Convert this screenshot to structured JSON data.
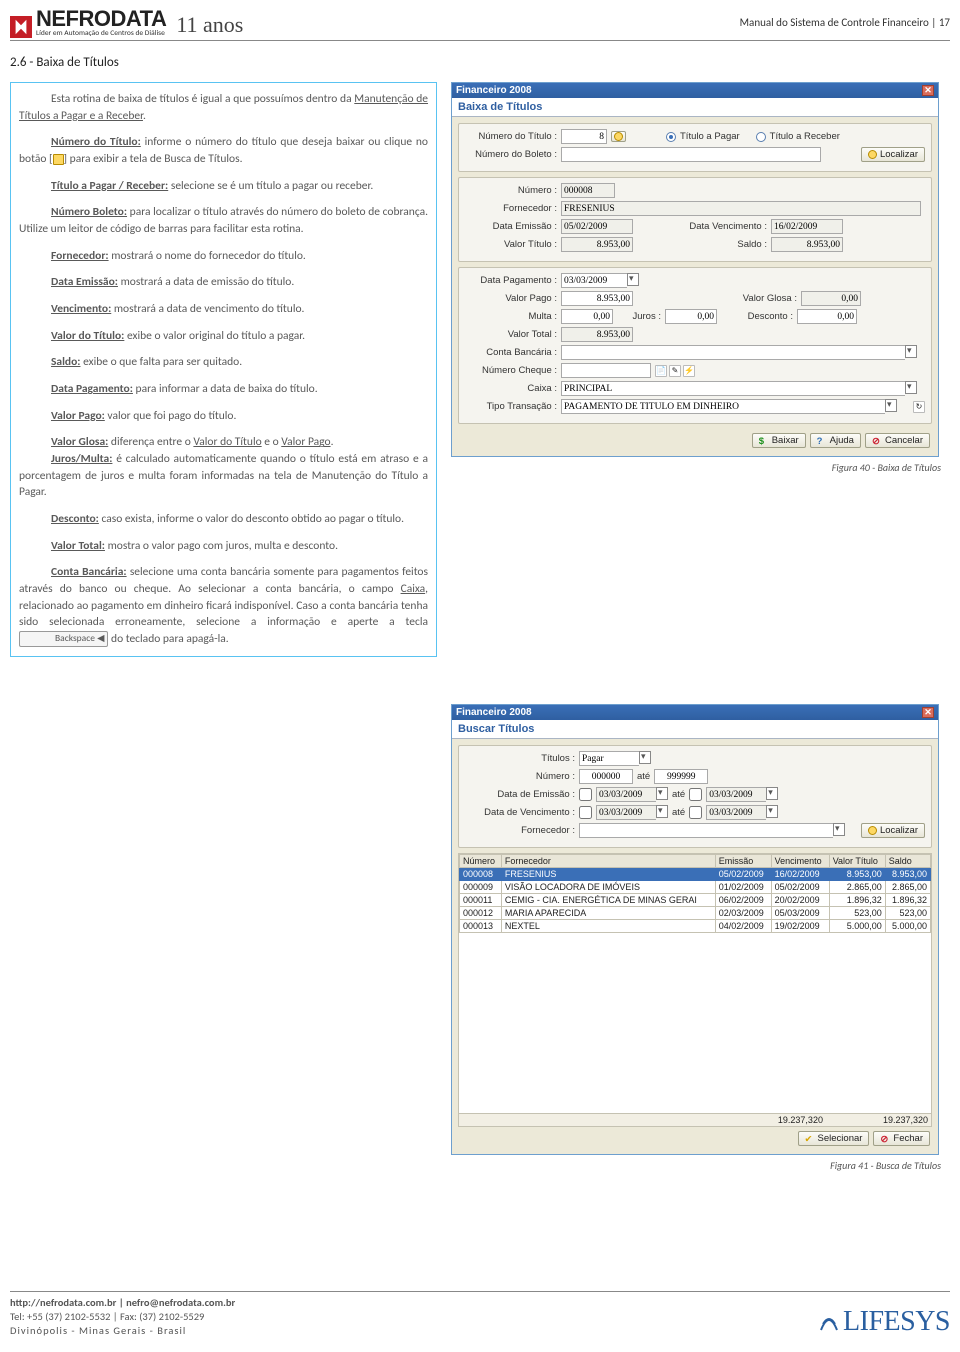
{
  "header": {
    "brand": "NEFRODATA",
    "brand_sub": "Líder em Automação de Centros de Diálise",
    "years": "11 anos",
    "manual": "Manual do Sistema de Controle Financeiro | 17"
  },
  "section_title": "2.6 - Baixa de Títulos",
  "paragraphs": {
    "intro_a": "Esta rotina de baixa de títulos é igual a que possuímos dentro da ",
    "intro_link": "Manutenção de Títulos a Pagar e a Receber",
    "intro_b": ".",
    "num_titulo_lbl": "Número do Título:",
    "num_titulo_a": " informe o número do título que deseja baixar ou clique no botão [",
    "num_titulo_b": "] para exibir a tela de Busca de Títulos.",
    "tit_pr_lbl": "Título a Pagar / Receber:",
    "tit_pr_txt": " selecione se é um título a pagar ou receber.",
    "num_boleto_lbl": "Número Boleto:",
    "num_boleto_txt": " para localizar o título através do número do boleto de cobrança. Utilize um leitor de código de barras para facilitar esta rotina.",
    "fornecedor_lbl": "Fornecedor:",
    "fornecedor_txt": " mostrará o nome do fornecedor do título.",
    "emissao_lbl": "Data Emissão:",
    "emissao_txt": " mostrará a data de emissão do título.",
    "venc_lbl": "Vencimento:",
    "venc_txt": " mostrará a data de vencimento do título.",
    "valor_lbl": "Valor do Título:",
    "valor_txt": " exibe o valor original do título a pagar.",
    "saldo_lbl": "Saldo:",
    "saldo_txt": " exibe o que falta para ser quitado.",
    "datapag_lbl": "Data Pagamento:",
    "datapag_txt": " para informar a data de baixa do título.",
    "valorpago_lbl": "Valor Pago:",
    "valorpago_txt": " valor que foi pago do título.",
    "valorglosa_lbl": "Valor Glosa:",
    "valorglosa_a": " diferença entre o ",
    "valorglosa_u1": "Valor do Título",
    "valorglosa_mid": " e o ",
    "valorglosa_u2": "Valor Pago",
    "valorglosa_b": ".",
    "juros_lbl": "Juros/Multa:",
    "juros_txt": " é calculado automaticamente quando o título está em atraso e a porcentagem de juros e multa foram informadas na tela de Manutenção do Título a Pagar.",
    "desconto_lbl": "Desconto:",
    "desconto_txt": " caso exista, informe o valor do desconto obtido ao pagar o título.",
    "valortotal_lbl": "Valor Total:",
    "valortotal_txt": " mostra o valor pago com juros, multa e desconto.",
    "conta_lbl": "Conta Bancária:",
    "conta_a": " selecione uma conta bancária somente para pagamentos feitos através do banco ou cheque. Ao selecionar a conta bancária, o campo ",
    "conta_caixa": "Caixa",
    "conta_b": ", relacionado ao pagamento em dinheiro ficará indisponível. Caso a conta bancária tenha sido selecionada erroneamente, selecione a informação e aperte a tecla ",
    "conta_c": " do teclado para apagá-la.",
    "backspace_key": "Backspace ◀"
  },
  "dlg1": {
    "app": "Financeiro 2008",
    "title": "Baixa de Títulos",
    "lbl_num_titulo": "Número do Título :",
    "val_num_titulo": "8",
    "radio_pagar": "Título a Pagar",
    "radio_receber": "Título a Receber",
    "lbl_num_boleto": "Número do Boleto :",
    "btn_localizar": "Localizar",
    "lbl_numero": "Número :",
    "val_numero": "000008",
    "lbl_fornecedor": "Fornecedor :",
    "val_fornecedor": "FRESENIUS",
    "lbl_emissao": "Data Emissão :",
    "val_emissao": "05/02/2009",
    "lbl_venc": "Data Vencimento :",
    "val_venc": "16/02/2009",
    "lbl_valor": "Valor Título :",
    "val_valor": "8.953,00",
    "lbl_saldo": "Saldo :",
    "val_saldo": "8.953,00",
    "lbl_datapag": "Data Pagamento :",
    "val_datapag": "03/03/2009",
    "lbl_valorpago": "Valor Pago :",
    "val_valorpago": "8.953,00",
    "lbl_valorglosa": "Valor Glosa :",
    "val_valorglosa": "0,00",
    "lbl_multa": "Multa :",
    "val_multa": "0,00",
    "lbl_juros": "Juros :",
    "val_juros": "0,00",
    "lbl_desconto": "Desconto :",
    "val_desconto": "0,00",
    "lbl_valortotal": "Valor Total :",
    "val_valortotal": "8.953,00",
    "lbl_conta": "Conta Bancária :",
    "lbl_cheque": "Número Cheque :",
    "lbl_caixa": "Caixa :",
    "val_caixa": "PRINCIPAL",
    "lbl_trans": "Tipo Transação :",
    "val_trans": "PAGAMENTO DE TÍTULO EM DINHEIRO",
    "btn_baixar": "Baixar",
    "btn_ajuda": "Ajuda",
    "btn_cancelar": "Cancelar",
    "caption": "Figura 40 - Baixa de Títulos"
  },
  "dlg2": {
    "app": "Financeiro 2008",
    "title": "Buscar Títulos",
    "lbl_titulos": "Títulos :",
    "val_titulos": "Pagar",
    "lbl_numero": "Número :",
    "val_num_from": "000000",
    "lbl_ate": "até",
    "val_num_to": "999999",
    "lbl_emissao": "Data de Emissão :",
    "val_date1": "03/03/2009",
    "val_date2": "03/03/2009",
    "lbl_venc": "Data de Vencimento :",
    "lbl_fornecedor": "Fornecedor :",
    "btn_localizar": "Localizar",
    "columns": [
      "Número",
      "Fornecedor",
      "Emissão",
      "Vencimento",
      "Valor Título",
      "Saldo"
    ],
    "rows": [
      {
        "num": "000008",
        "forn": "FRESENIUS",
        "emi": "05/02/2009",
        "ven": "16/02/2009",
        "val": "8.953,00",
        "sal": "8.953,00",
        "sel": true
      },
      {
        "num": "000009",
        "forn": "VISÃO LOCADORA DE IMÓVEIS",
        "emi": "01/02/2009",
        "ven": "05/02/2009",
        "val": "2.865,00",
        "sal": "2.865,00"
      },
      {
        "num": "000011",
        "forn": "CEMIG - CIA. ENERGÉTICA DE MINAS GERAI",
        "emi": "06/02/2009",
        "ven": "20/02/2009",
        "val": "1.896,32",
        "sal": "1.896,32"
      },
      {
        "num": "000012",
        "forn": "MARIA APARECIDA",
        "emi": "02/03/2009",
        "ven": "05/03/2009",
        "val": "523,00",
        "sal": "523,00"
      },
      {
        "num": "000013",
        "forn": "NEXTEL",
        "emi": "04/02/2009",
        "ven": "19/02/2009",
        "val": "5.000,00",
        "sal": "5.000,00"
      }
    ],
    "total_val": "19.237,320",
    "total_sal": "19.237,320",
    "btn_selecionar": "Selecionar",
    "btn_fechar": "Fechar",
    "caption": "Figura 41 - Busca de Títulos"
  },
  "footer": {
    "url": "http://nefrodata.com.br | nefro@nefrodata.com.br",
    "tel": "Tel: +55 (37) 2102-5532 | Fax: (37) 2102-5529",
    "loc": "Divinópolis     -     Minas Gerais     -     Brasil",
    "lifesys": "LIFESYS"
  }
}
